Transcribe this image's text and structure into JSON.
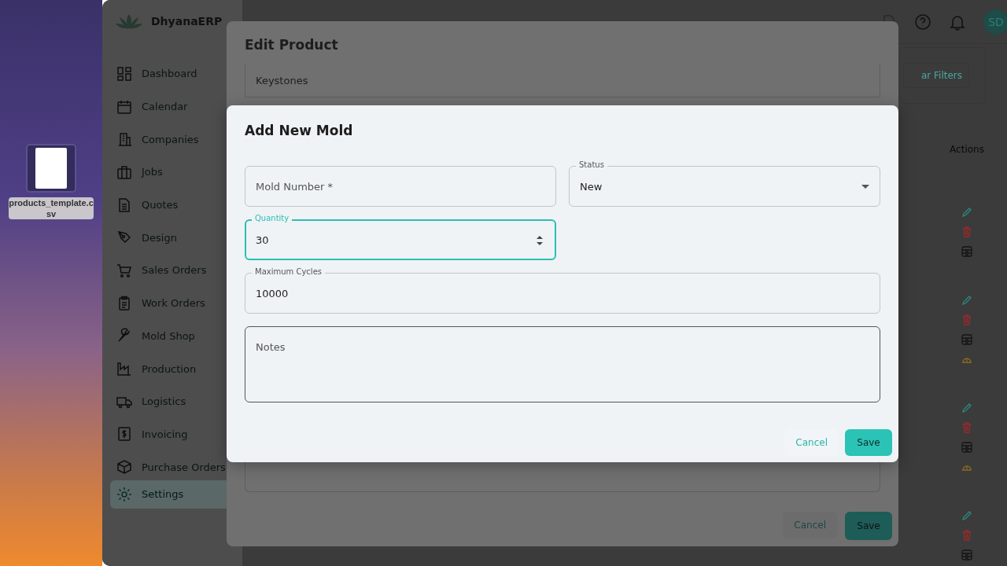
{
  "desktop": {
    "file_name": "products_template.csv"
  },
  "app": {
    "name": "DhyanaERP",
    "avatar": "SD"
  },
  "sidebar": {
    "items": [
      {
        "label": "Dashboard",
        "selected": false
      },
      {
        "label": "Calendar",
        "selected": false
      },
      {
        "label": "Companies",
        "selected": false
      },
      {
        "label": "Jobs",
        "selected": false
      },
      {
        "label": "Quotes",
        "selected": false
      },
      {
        "label": "Design",
        "selected": false
      },
      {
        "label": "Sales Orders",
        "selected": false
      },
      {
        "label": "Work Orders",
        "selected": false
      },
      {
        "label": "Mold Shop",
        "selected": false
      },
      {
        "label": "Production",
        "selected": false
      },
      {
        "label": "Logistics",
        "selected": false
      },
      {
        "label": "Invoicing",
        "selected": false
      },
      {
        "label": "Purchase Orders",
        "selected": false
      },
      {
        "label": "Settings",
        "selected": true
      }
    ]
  },
  "background_page": {
    "filter_button": "ar Filters",
    "table_header": "Actions",
    "action_rows": [
      {
        "icons": [
          {
            "kind": "edit"
          },
          {
            "kind": "delete"
          },
          {
            "kind": "archive"
          }
        ]
      },
      {
        "icons": [
          {
            "kind": "edit"
          },
          {
            "kind": "delete"
          },
          {
            "kind": "archive"
          },
          {
            "kind": "build"
          }
        ]
      },
      {
        "icons": [
          {
            "kind": "edit"
          },
          {
            "kind": "delete"
          },
          {
            "kind": "archive"
          },
          {
            "kind": "build"
          }
        ]
      },
      {
        "icons": [
          {
            "kind": "edit"
          },
          {
            "kind": "delete"
          },
          {
            "kind": "archive"
          }
        ]
      }
    ]
  },
  "edit_product_dialog": {
    "title": "Edit Product",
    "field_value": "Keystones",
    "cancel": "Cancel",
    "save": "Save"
  },
  "add_mold_dialog": {
    "title": "Add New Mold",
    "fields": [
      {
        "kind": "text",
        "placeholder": "Mold Number *",
        "focused": false
      },
      {
        "kind": "select",
        "label": "Status",
        "value": "New",
        "focused": false
      },
      {
        "kind": "number",
        "label": "Quantity",
        "value": "30",
        "focused": true
      },
      {
        "kind": "text",
        "label": "Maximum Cycles",
        "value": "10000",
        "focused": false
      },
      {
        "kind": "textarea",
        "placeholder": "Notes",
        "focused": false
      }
    ],
    "cancel": "Cancel",
    "save": "Save"
  }
}
